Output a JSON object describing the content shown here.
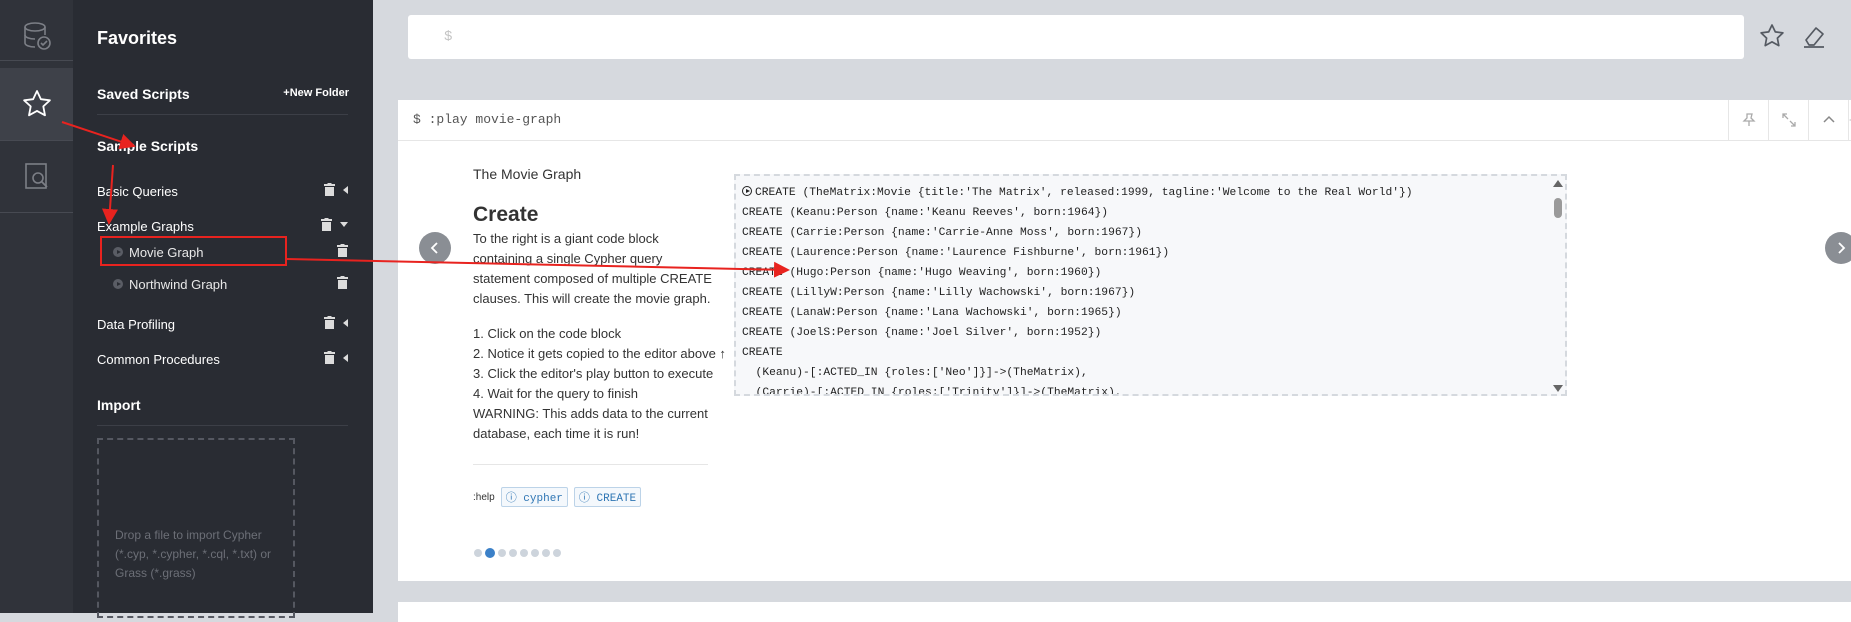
{
  "drawer": {
    "title": "Favorites",
    "saved_scripts": "Saved Scripts",
    "new_folder": "New Folder",
    "sample_scripts": "Sample Scripts",
    "folders": [
      {
        "label": "Basic Queries",
        "expanded": false
      },
      {
        "label": "Example Graphs",
        "expanded": true
      },
      {
        "label": "Data Profiling",
        "expanded": false
      },
      {
        "label": "Common Procedures",
        "expanded": false
      }
    ],
    "scripts": [
      {
        "label": "Movie Graph",
        "highlighted": true
      },
      {
        "label": "Northwind Graph",
        "highlighted": false
      }
    ],
    "import_title": "Import",
    "dropzone_text": "Drop a file to import Cypher (*.cyp, *.cypher, *.cql, *.txt) or Grass (*.grass)"
  },
  "editor": {
    "prompt": "$"
  },
  "frame": {
    "command": "$ :play movie-graph",
    "slide": {
      "title": "The Movie Graph",
      "heading": "Create",
      "intro": "To the right is a giant code block containing a single Cypher query statement composed of multiple CREATE clauses. This will create the movie graph.",
      "steps": [
        "1. Click on the code block",
        "2. Notice it gets copied to the editor above ↑",
        "3. Click the editor's play button to execute",
        "4. Wait for the query to finish",
        "WARNING: This adds data to the current",
        "database, each time it is run!"
      ],
      "help_label": ":help",
      "help_chips": [
        "cypher",
        "CREATE"
      ],
      "pages_total": 8,
      "page_active": 2
    },
    "code_lines": [
      "CREATE (TheMatrix:Movie {title:'The Matrix', released:1999, tagline:'Welcome to the Real World'})",
      "CREATE (Keanu:Person {name:'Keanu Reeves', born:1964})",
      "CREATE (Carrie:Person {name:'Carrie-Anne Moss', born:1967})",
      "CREATE (Laurence:Person {name:'Laurence Fishburne', born:1961})",
      "CREATE (Hugo:Person {name:'Hugo Weaving', born:1960})",
      "CREATE (LillyW:Person {name:'Lilly Wachowski', born:1967})",
      "CREATE (LanaW:Person {name:'Lana Wachowski', born:1965})",
      "CREATE (JoelS:Person {name:'Joel Silver', born:1952})",
      "CREATE",
      "  (Keanu)-[:ACTED_IN {roles:['Neo']}]->(TheMatrix),",
      "  (Carrie)-[:ACTED_IN {roles:['Trinity']}]->(TheMatrix),"
    ]
  },
  "colors": {
    "rail": "#30333a",
    "drawer": "#292c33",
    "accent_blue": "#3b80c8",
    "annotation_red": "#e8231f"
  },
  "icons": {
    "rail": [
      "database-icon",
      "star-icon",
      "search-doc-icon"
    ],
    "editor": [
      "star-icon",
      "eraser-icon"
    ],
    "frame": [
      "pin-icon",
      "expand-icon",
      "collapse-icon",
      "close-icon"
    ]
  }
}
